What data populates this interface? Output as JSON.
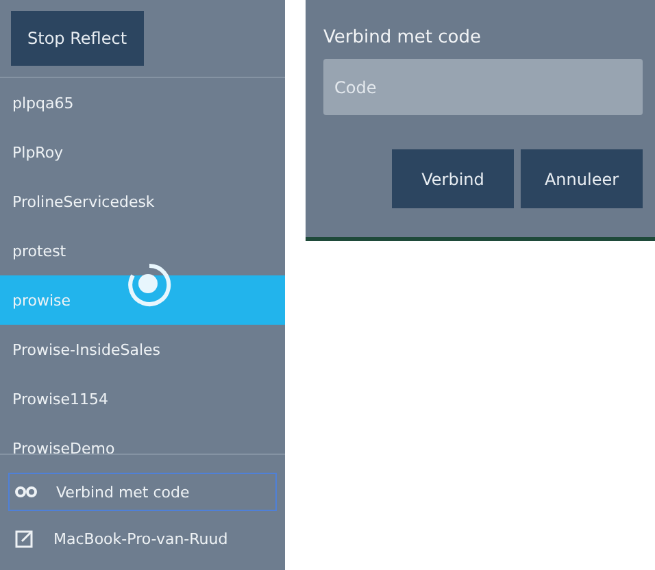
{
  "sidebar": {
    "stop_button": "Stop Reflect",
    "devices": [
      {
        "label": "plpqa65",
        "selected": false
      },
      {
        "label": "PlpRoy",
        "selected": false
      },
      {
        "label": "ProlineServicedesk",
        "selected": false
      },
      {
        "label": "protest",
        "selected": false
      },
      {
        "label": "prowise",
        "selected": true
      },
      {
        "label": "Prowise-InsideSales",
        "selected": false
      },
      {
        "label": "Prowise1154",
        "selected": false
      },
      {
        "label": "ProwiseDemo",
        "selected": false
      }
    ],
    "actions": [
      {
        "kind": "code",
        "label": "Verbind met code",
        "selected": true
      },
      {
        "kind": "device",
        "label": "MacBook-Pro-van-Ruud",
        "selected": false
      }
    ]
  },
  "dialog": {
    "title": "Verbind met code",
    "field": {
      "placeholder": "Code"
    },
    "buttons": [
      "Verbind",
      "Annuleer"
    ]
  }
}
